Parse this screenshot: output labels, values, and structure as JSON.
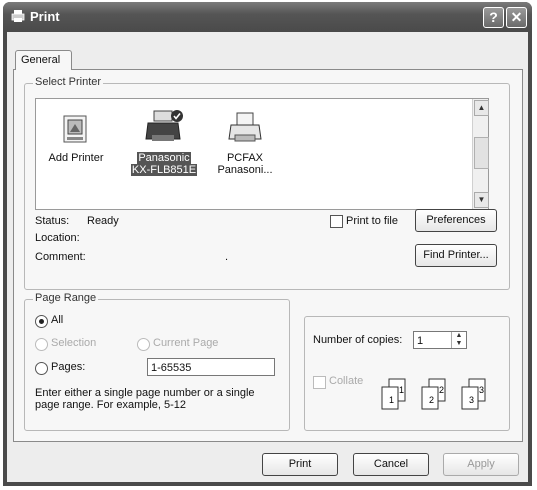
{
  "window": {
    "title": "Print",
    "help_label": "?",
    "close_label": "✕"
  },
  "tabs": [
    {
      "label": "General"
    }
  ],
  "select_printer": {
    "legend": "Select Printer",
    "printers": [
      {
        "label": "Add Printer"
      },
      {
        "label_line1": "Panasonic",
        "label_line2": "KX-FLB851E"
      },
      {
        "label_line1": "PCFAX",
        "label_line2": "Panasoni..."
      }
    ],
    "status_label": "Status:",
    "status_value": "Ready",
    "location_label": "Location:",
    "location_value": "",
    "comment_label": "Comment:",
    "comment_value": ".",
    "print_to_file_label": "Print to file",
    "preferences_label": "Preferences",
    "find_printer_label": "Find Printer..."
  },
  "page_range": {
    "legend": "Page Range",
    "all_label": "All",
    "selection_label": "Selection",
    "current_page_label": "Current Page",
    "pages_label": "Pages:",
    "pages_value": "1-65535",
    "hint": "Enter either a single page number or a single page range.  For example, 5-12"
  },
  "copies": {
    "number_label": "Number of copies:",
    "number_value": "1",
    "collate_label": "Collate",
    "collate_pages": [
      "1",
      "2",
      "3"
    ]
  },
  "footer": {
    "print_label": "Print",
    "cancel_label": "Cancel",
    "apply_label": "Apply"
  }
}
